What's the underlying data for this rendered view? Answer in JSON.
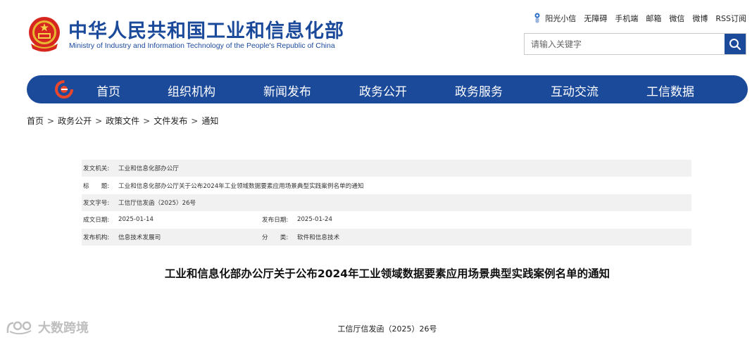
{
  "header": {
    "title_cn": "中华人民共和国工业和信息化部",
    "title_en": "Ministry of Industry and Information Technology of the People's Republic of China",
    "top_links": [
      "阳光小信",
      "无障碍",
      "手机端",
      "邮箱",
      "微信",
      "微博",
      "RSS订阅"
    ],
    "search_placeholder": "请输入关键字"
  },
  "nav": {
    "items": [
      "首页",
      "组织机构",
      "新闻发布",
      "政务公开",
      "政务服务",
      "互动交流",
      "工信数据"
    ]
  },
  "breadcrumb": [
    "首页",
    "政务公开",
    "政策文件",
    "文件发布",
    "通知"
  ],
  "info": {
    "issuer_label": "发文机关:",
    "issuer": "工业和信息化部办公厅",
    "title_label": "标　　题:",
    "title": "工业和信息化部办公厅关于公布2024年工业领域数据要素应用场景典型实践案例名单的通知",
    "doc_no_label": "发文字号:",
    "doc_no": "工信厅信发函（2025）26号",
    "created_label": "成文日期:",
    "created": "2025-01-14",
    "published_label": "发布日期:",
    "published": "2025-01-24",
    "org_label": "发布机构:",
    "org": "信息技术发展司",
    "category_label": "分　　类:",
    "category": "软件和信息技术"
  },
  "article": {
    "title": "工业和信息化部办公厅关于公布2024年工业领域数据要素应用场景典型实践案例名单的通知",
    "doc_number": "工信厅信发函（2025）26号"
  },
  "watermark": "大数跨境",
  "colors": {
    "brand": "#1c4a9b",
    "row_alt": "#f1f1f1"
  }
}
